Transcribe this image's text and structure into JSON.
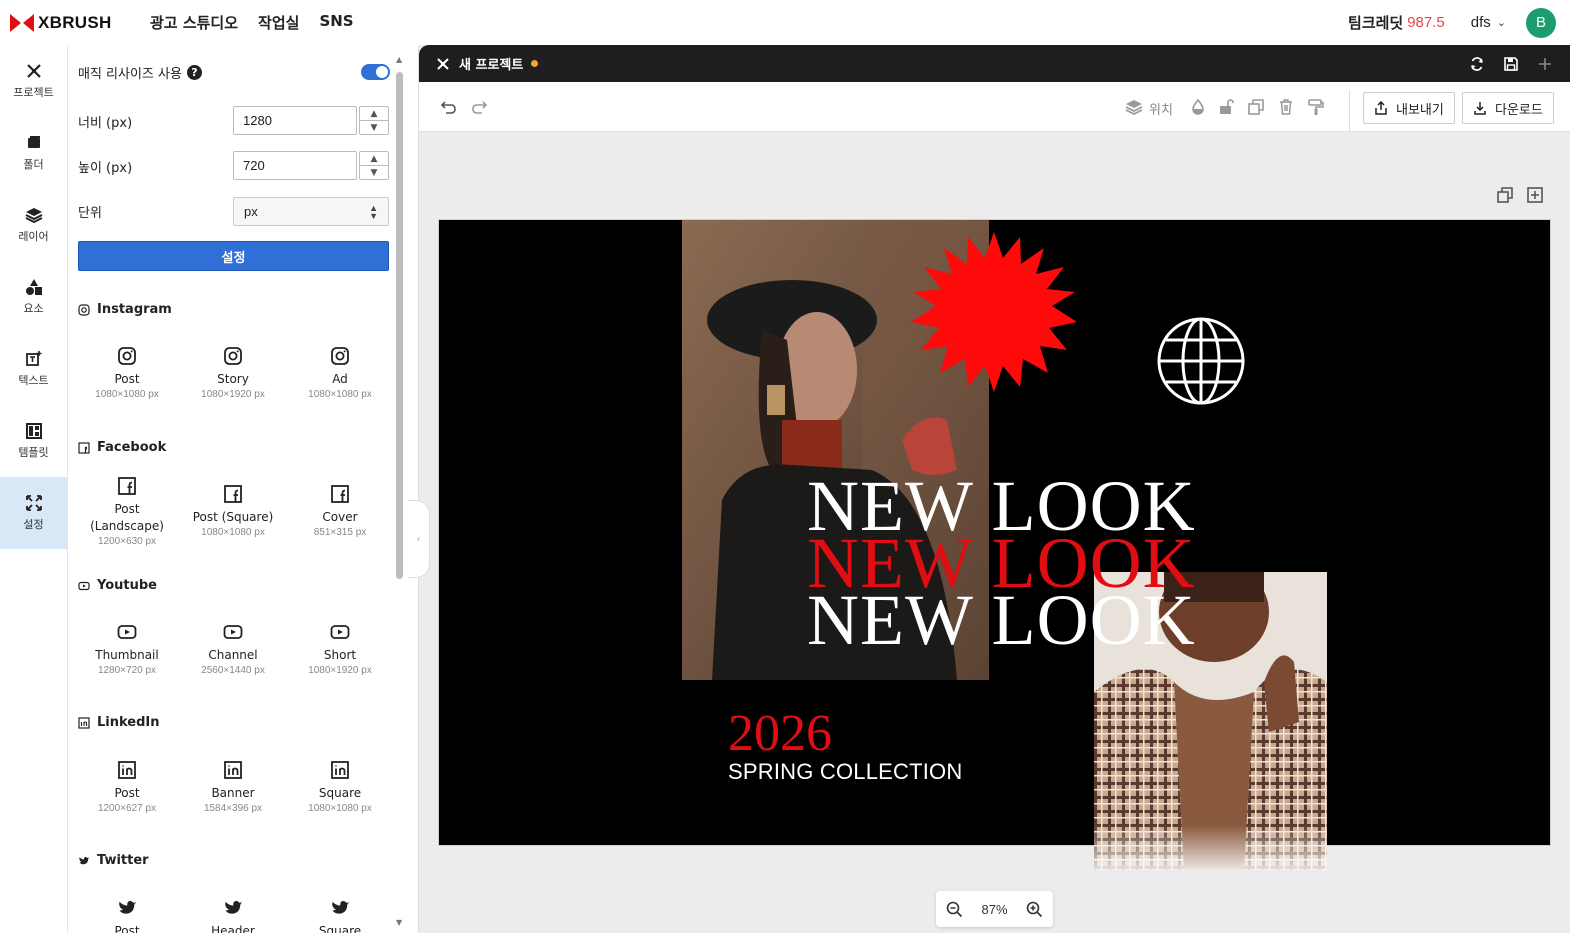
{
  "brand": {
    "name": "XBRUSH",
    "accent": "#e00d12"
  },
  "nav": {
    "links": [
      "광고 스튜디오",
      "작업실",
      "SNS"
    ]
  },
  "account": {
    "credit_label": "팀크레딧",
    "credit_value": "987.5",
    "user_name": "dfs",
    "avatar_initial": "B"
  },
  "rail": {
    "items": [
      {
        "label": "프로젝트",
        "icon": "project-icon"
      },
      {
        "label": "폴더",
        "icon": "folder-icon"
      },
      {
        "label": "레이어",
        "icon": "layers-icon"
      },
      {
        "label": "요소",
        "icon": "elements-icon"
      },
      {
        "label": "텍스트",
        "icon": "text-icon"
      },
      {
        "label": "템플릿",
        "icon": "template-icon"
      },
      {
        "label": "설정",
        "icon": "settings-resize-icon",
        "active": true
      }
    ]
  },
  "panel": {
    "magic_resize_label": "매직 리사이즈 사용",
    "magic_resize_on": true,
    "width_label": "너비 (px)",
    "width_value": "1280",
    "height_label": "높이 (px)",
    "height_value": "720",
    "unit_label": "단위",
    "unit_value": "px",
    "apply_label": "설정",
    "sections": [
      {
        "title": "Instagram",
        "presets": [
          {
            "name": "Post",
            "size": "1080×1080 px"
          },
          {
            "name": "Story",
            "size": "1080×1920 px"
          },
          {
            "name": "Ad",
            "size": "1080×1080 px"
          }
        ]
      },
      {
        "title": "Facebook",
        "presets": [
          {
            "name": "Post\n(Landscape)",
            "size": "1200×630 px"
          },
          {
            "name": "Post (Square)",
            "size": "1080×1080 px"
          },
          {
            "name": "Cover",
            "size": "851×315 px"
          }
        ]
      },
      {
        "title": "Youtube",
        "presets": [
          {
            "name": "Thumbnail",
            "size": "1280×720 px"
          },
          {
            "name": "Channel",
            "size": "2560×1440 px"
          },
          {
            "name": "Short",
            "size": "1080×1920 px"
          }
        ]
      },
      {
        "title": "LinkedIn",
        "presets": [
          {
            "name": "Post",
            "size": "1200×627 px"
          },
          {
            "name": "Banner",
            "size": "1584×396 px"
          },
          {
            "name": "Square",
            "size": "1080×1080 px"
          }
        ]
      },
      {
        "title": "Twitter",
        "presets": [
          {
            "name": "Post",
            "size": ""
          },
          {
            "name": "Header",
            "size": ""
          },
          {
            "name": "Square",
            "size": ""
          }
        ]
      }
    ]
  },
  "workspace": {
    "tab_title": "새 프로젝트",
    "position_label": "위치",
    "export_label": "내보내기",
    "download_label": "다운로드",
    "zoom": "87%"
  },
  "design": {
    "headline": "NEW LOOK",
    "year": "2026",
    "subline": "SPRING COLLECTION",
    "headline_colors": [
      "#ffffff",
      "#e00d12",
      "#ffffff"
    ]
  }
}
